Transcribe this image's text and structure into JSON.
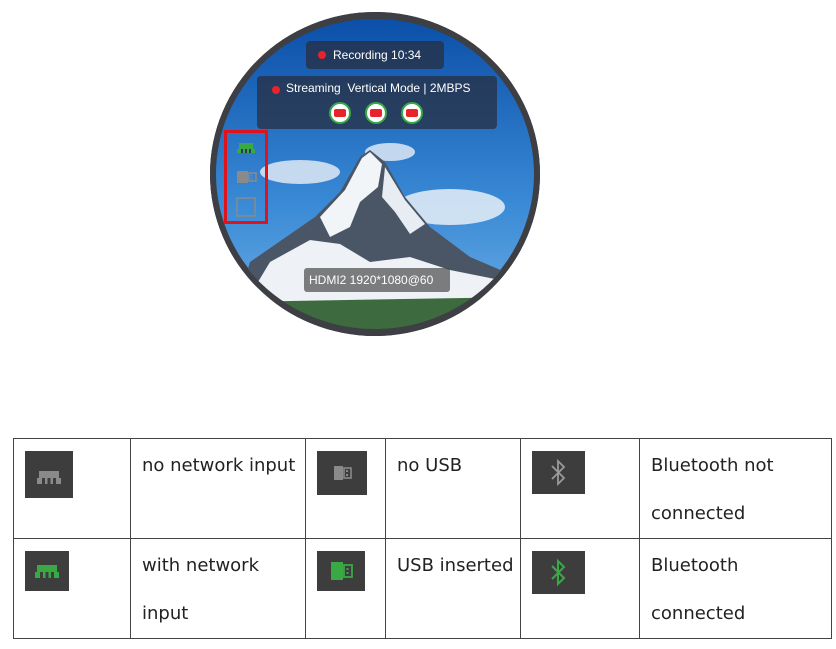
{
  "screen": {
    "recording_label": "Recording 10:34",
    "streaming_label": "Streaming  Vertical Mode | 2MBPS",
    "platform_icons": [
      "youtube-icon",
      "youtube-icon",
      "youtube-icon"
    ],
    "hdmi_label": "HDMI2 1920*1080@60",
    "status_icons": [
      "network-icon",
      "usb-icon",
      "bluetooth-icon"
    ],
    "colors": {
      "recording_dot": "#e8232a",
      "highlight_box": "#e0121b",
      "active_icon": "#3aa845",
      "inactive_icon": "#8a8a8a"
    }
  },
  "legend": {
    "rows": [
      {
        "network": {
          "icon": "network-icon",
          "state": "inactive",
          "label": "no network input"
        },
        "usb": {
          "icon": "usb-icon",
          "state": "inactive",
          "label": "no USB"
        },
        "bluetooth": {
          "icon": "bluetooth-icon",
          "state": "inactive",
          "label": "Bluetooth not connected"
        }
      },
      {
        "network": {
          "icon": "network-icon",
          "state": "active",
          "label": "with network input"
        },
        "usb": {
          "icon": "usb-icon",
          "state": "active",
          "label": "USB inserted"
        },
        "bluetooth": {
          "icon": "bluetooth-icon",
          "state": "active",
          "label": "Bluetooth connected"
        }
      }
    ]
  }
}
